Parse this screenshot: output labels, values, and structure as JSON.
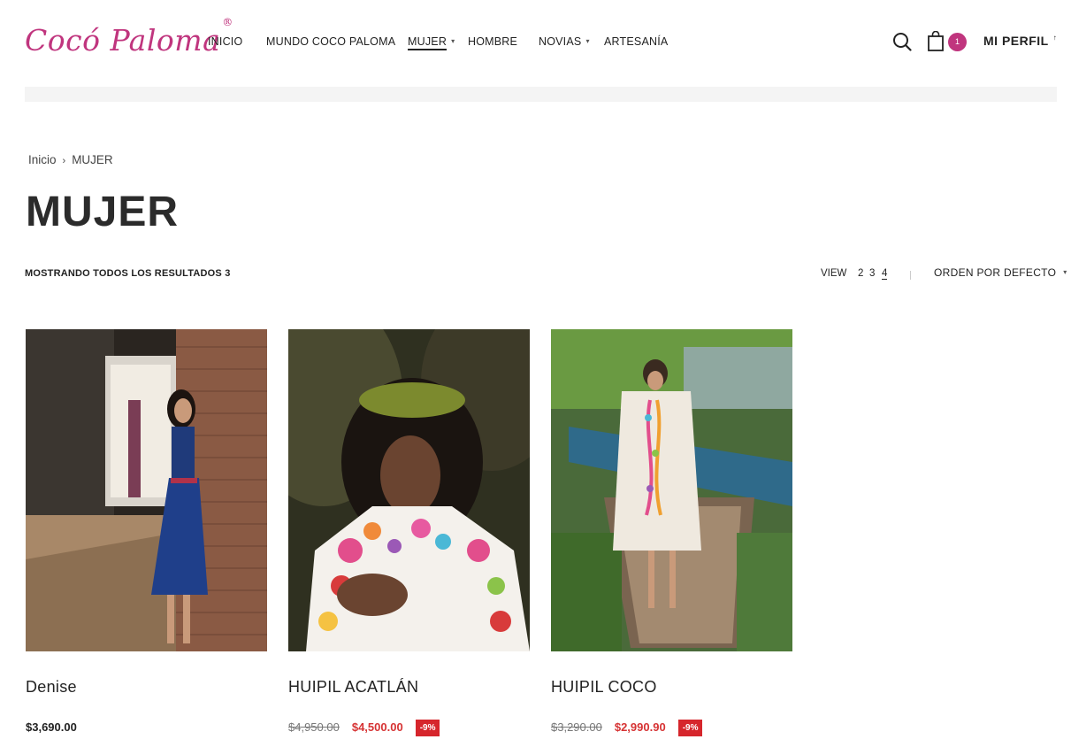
{
  "header": {
    "logo_text": "Cocó Paloma",
    "logo_mark": "®",
    "nav": [
      {
        "label": "INICIO",
        "has_dropdown": false
      },
      {
        "label": "MUNDO COCO PALOMA",
        "has_dropdown": false
      },
      {
        "label": "MUJER",
        "has_dropdown": true,
        "active": true
      },
      {
        "label": "HOMBRE",
        "has_dropdown": false
      },
      {
        "label": "NOVIAS",
        "has_dropdown": true
      },
      {
        "label": "ARTESANÍA",
        "has_dropdown": false
      }
    ],
    "search_icon": "search-icon",
    "cart_icon": "shopping-bag-icon",
    "cart_count": "1",
    "profile_label": "MI PERFIL",
    "profile_mark": "↑"
  },
  "breadcrumb": {
    "home": "Inicio",
    "separator": "›",
    "current": "MUJER"
  },
  "page_title": "MUJER",
  "toolbar": {
    "results_text": "MOSTRANDO TODOS LOS RESULTADOS 3",
    "view_label": "VIEW",
    "view_options": [
      "2",
      "3",
      "4"
    ],
    "view_active": "4",
    "sort_label": "ORDEN POR DEFECTO"
  },
  "products": [
    {
      "name": "Denise",
      "price": "$3,690.00"
    },
    {
      "name": "HUIPIL ACATLÁN",
      "old_price": "$4,950.00",
      "new_price": "$4,500.00",
      "discount": "-9%"
    },
    {
      "name": "HUIPIL COCO",
      "old_price": "$3,290.00",
      "new_price": "$2,990.90",
      "discount": "-9%"
    }
  ],
  "colors": {
    "brand": "#c0357e",
    "sale": "#d63334",
    "text": "#222222"
  }
}
